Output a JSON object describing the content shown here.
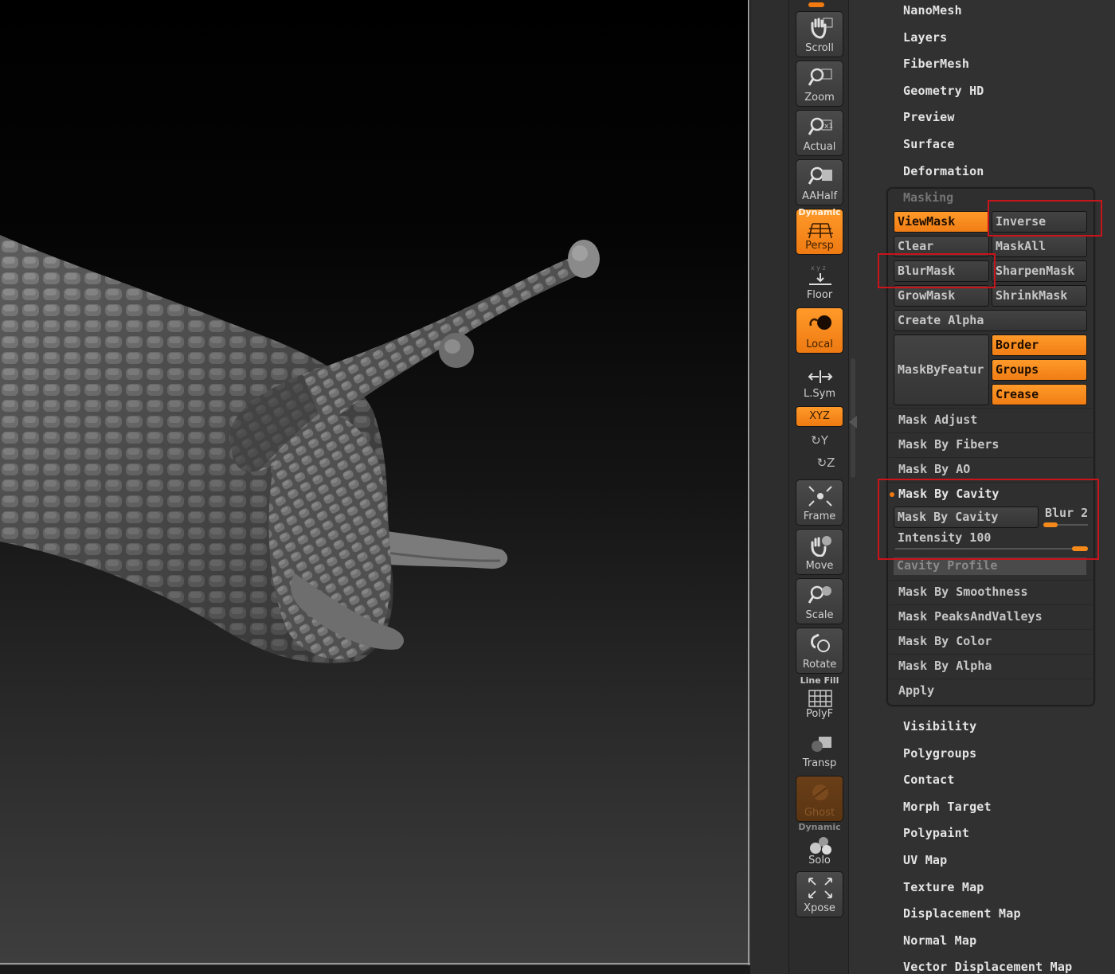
{
  "viewport": {
    "description_label": ""
  },
  "shelf": {
    "buttons": [
      {
        "id": "scroll",
        "label": "Scroll",
        "icon": "hand-icon",
        "active": false
      },
      {
        "id": "zoom",
        "label": "Zoom",
        "icon": "magnifier-icon",
        "active": false
      },
      {
        "id": "actual",
        "label": "Actual",
        "icon": "magnifier-1x-icon",
        "active": false
      },
      {
        "id": "aahalf",
        "label": "AAHalf",
        "icon": "magnifier-half-icon",
        "active": false
      },
      {
        "id": "persp",
        "label": "Persp",
        "sup": "Dynamic",
        "icon": "perspective-grid-icon",
        "active": true
      },
      {
        "id": "floor",
        "label": "Floor",
        "icon": "floor-icon",
        "active": false
      },
      {
        "id": "local",
        "label": "Local",
        "icon": "local-rotate-icon",
        "active": true
      },
      {
        "id": "lsym",
        "label": "L.Sym",
        "icon": "symmetry-arrows-icon",
        "active": false
      },
      {
        "id": "frame",
        "label": "Frame",
        "icon": "frame-icon",
        "active": false
      },
      {
        "id": "move",
        "label": "Move",
        "icon": "move-hand-icon",
        "active": false
      },
      {
        "id": "scale",
        "label": "Scale",
        "icon": "scale-icon",
        "active": false
      },
      {
        "id": "rotate",
        "label": "Rotate",
        "icon": "rotate-icon",
        "active": false
      },
      {
        "id": "polyf",
        "label": "PolyF",
        "sup": "Line Fill",
        "icon": "polyframe-grid-icon",
        "active": false
      },
      {
        "id": "transp",
        "label": "Transp",
        "icon": "transparency-icon",
        "active": false
      },
      {
        "id": "ghost",
        "label": "Ghost",
        "icon": "ghost-icon",
        "active": false
      },
      {
        "id": "solo",
        "label": "Solo",
        "sup": "Dynamic",
        "icon": "solo-spheres-icon",
        "active": false
      },
      {
        "id": "xpose",
        "label": "Xpose",
        "icon": "xpose-arrows-icon",
        "active": false
      }
    ],
    "xyz_label": "XYZ",
    "y_glyph": "↻Y",
    "z_glyph": "↻Z"
  },
  "palette": {
    "top_subpalettes": [
      "NanoMesh",
      "Layers",
      "FiberMesh",
      "Geometry HD",
      "Preview",
      "Surface",
      "Deformation"
    ],
    "masking": {
      "header": "Masking",
      "viewmask": "ViewMask",
      "inverse": "Inverse",
      "clear": "Clear",
      "maskall": "MaskAll",
      "blurmask": "BlurMask",
      "sharpenmask": "SharpenMask",
      "growmask": "GrowMask",
      "shrinkmask": "ShrinkMask",
      "create_alpha": "Create Alpha",
      "maskbyfeature": "MaskByFeatur",
      "border": "Border",
      "groups": "Groups",
      "crease": "Crease",
      "rows_a": [
        "Mask Adjust",
        "Mask By Fibers",
        "Mask By AO"
      ],
      "cavity_open": "Mask By Cavity",
      "cavity_button": "Mask By Cavity",
      "blur_label": "Blur 2",
      "blur_value": 2,
      "intensity_label": "Intensity 100",
      "intensity_value": 100,
      "cavity_profile": "Cavity Profile",
      "rows_b": [
        "Mask By Smoothness",
        "Mask PeaksAndValleys",
        "Mask By Color",
        "Mask By Alpha",
        "Apply"
      ]
    },
    "bottom_subpalettes": [
      "Visibility",
      "Polygroups",
      "Contact",
      "Morph Target",
      "Polypaint",
      "UV Map",
      "Texture Map",
      "Displacement Map",
      "Normal Map",
      "Vector Displacement Map"
    ]
  },
  "colors": {
    "accent": "#f07a10",
    "highlight": "#c8141a",
    "panel": "#313131"
  }
}
